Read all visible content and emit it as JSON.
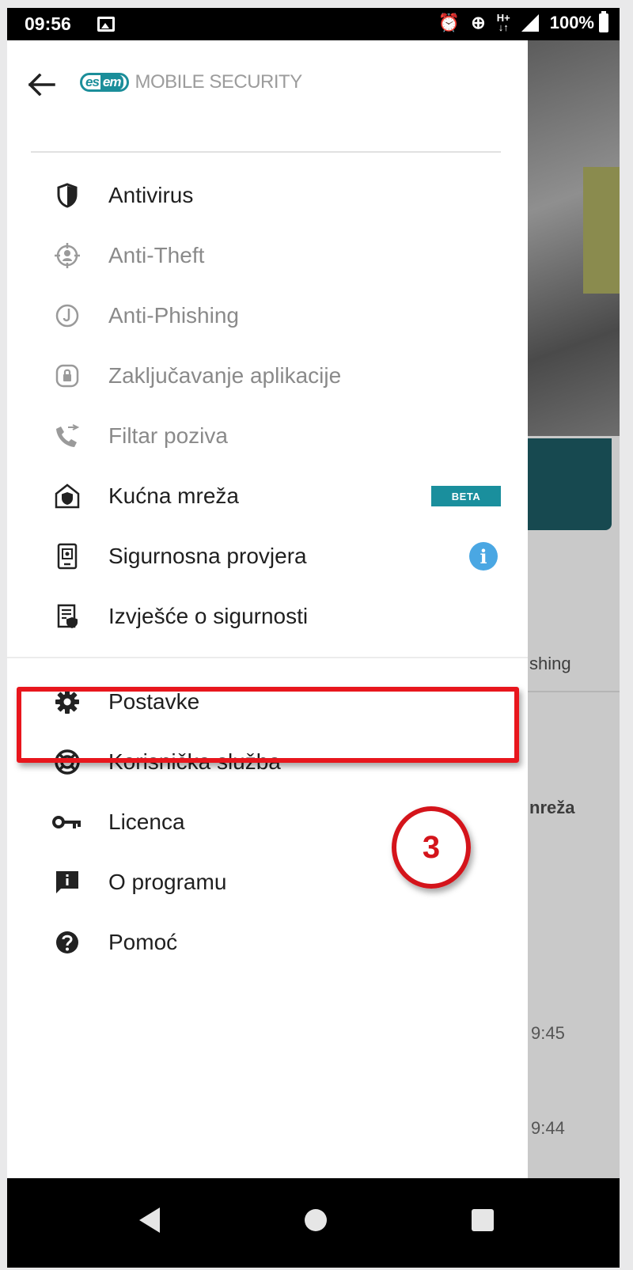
{
  "status_bar": {
    "time": "09:56",
    "network": "H+",
    "battery": "100%"
  },
  "background_app": {
    "label_phishing": "shing",
    "label_mreza": "nreža",
    "time_1": "9:45",
    "time_2": "9:44"
  },
  "drawer": {
    "logo_badge": "es",
    "logo_badge_tail": "eт",
    "logo_text": "MOBILE SECURITY",
    "items": [
      {
        "label": "Antivirus",
        "icon": "shield-icon",
        "dim": false
      },
      {
        "label": "Anti-Theft",
        "icon": "target-icon",
        "dim": true
      },
      {
        "label": "Anti-Phishing",
        "icon": "fish-hook-icon",
        "dim": true
      },
      {
        "label": "Zaključavanje aplikacije",
        "icon": "app-lock-icon",
        "dim": true
      },
      {
        "label": "Filtar poziva",
        "icon": "call-filter-icon",
        "dim": true
      },
      {
        "label": "Kućna mreža",
        "icon": "home-network-icon",
        "dim": false,
        "badge": "BETA"
      },
      {
        "label": "Sigurnosna provjera",
        "icon": "security-check-icon",
        "dim": false,
        "badge": "i"
      },
      {
        "label": "Izvješće o sigurnosti",
        "icon": "report-icon",
        "dim": false
      },
      {
        "label": "Postavke",
        "icon": "gear-icon",
        "dim": false
      },
      {
        "label": "Korisnička služba",
        "icon": "lifebuoy-icon",
        "dim": false
      },
      {
        "label": "Licenca",
        "icon": "key-icon",
        "dim": false
      },
      {
        "label": "O programu",
        "icon": "about-icon",
        "dim": false
      },
      {
        "label": "Pomoć",
        "icon": "help-icon",
        "dim": false
      }
    ]
  },
  "annotation": {
    "step_number": "3"
  },
  "colors": {
    "accent": "#1a8f9d",
    "highlight": "#e8161d",
    "info": "#4aa7e3"
  }
}
